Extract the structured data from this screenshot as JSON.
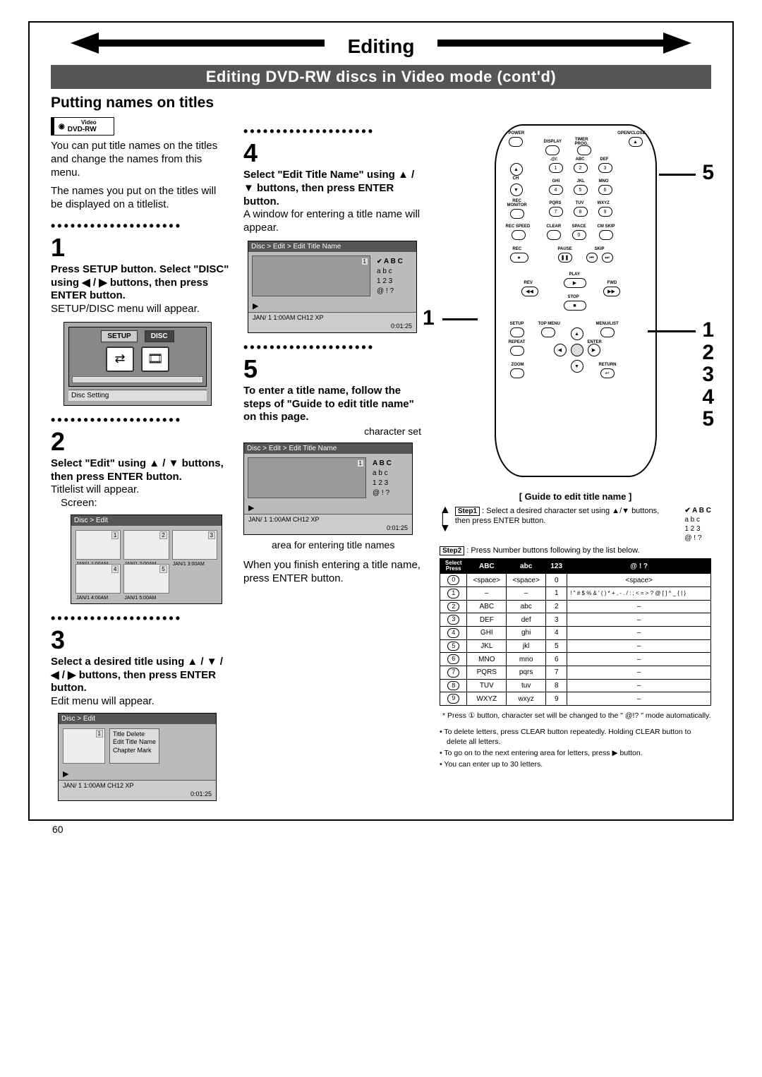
{
  "header": {
    "title": "Editing",
    "subtitle": "Editing DVD-RW discs in Video mode (cont'd)"
  },
  "section_title": "Putting names on titles",
  "badge": {
    "top": "Video",
    "bottom": "DVD-RW"
  },
  "intro": {
    "p1": "You can put title names on the titles and change the names from this menu.",
    "p2": "The names you put on the titles will be displayed on a titlelist."
  },
  "steps": {
    "s1": {
      "num": "1",
      "bold": "Press SETUP button. Select \"DISC\" using ◀ / ▶ buttons, then press ENTER button.",
      "body": "SETUP/DISC menu will appear.",
      "screen": {
        "tab1": "SETUP",
        "tab2": "DISC",
        "footer": "Disc Setting"
      }
    },
    "s2": {
      "num": "2",
      "bold": "Select \"Edit\" using ▲ / ▼ buttons, then press ENTER button.",
      "body": "Titlelist will appear.",
      "screen_label": "Screen:",
      "tl": {
        "header": "Disc > Edit",
        "items": [
          "JAN/1  1:00AM",
          "JAN/1  2:00AM",
          "JAN/1  3:00AM",
          "JAN/1  4:00AM",
          "JAN/1  5:00AM"
        ],
        "nums": [
          "1",
          "2",
          "3",
          "4",
          "5"
        ]
      }
    },
    "s3": {
      "num": "3",
      "bold": "Select a desired title using ▲ / ▼ / ◀ / ▶ buttons, then press ENTER button.",
      "body": "Edit menu will appear.",
      "em": {
        "header": "Disc > Edit",
        "menu": [
          "Title Delete",
          "Edit Title Name",
          "Chapter Mark"
        ],
        "status": "JAN/ 1   1:00AM  CH12     XP",
        "time": "0:01:25",
        "num": "1",
        "play": "▶"
      }
    },
    "s4": {
      "num": "4",
      "bold": "Select \"Edit Title Name\" using ▲ / ▼ buttons, then press ENTER button.",
      "body": "A window for entering a title name will appear.",
      "ent": {
        "header": "Disc > Edit > Edit Title Name",
        "charset": [
          "A B C",
          "a b c",
          "1 2 3",
          "@ ! ?"
        ],
        "status": "JAN/ 1   1:00AM  CH12   XP",
        "time": "0:01:25",
        "num": "1",
        "play": "▶"
      }
    },
    "s5": {
      "num": "5",
      "bold": "To enter a title name, follow the steps of \"Guide to edit title name\" on this page.",
      "cap_charset": "character set",
      "cap_area": "area for entering title names",
      "body2": "When you finish entering a title name, press ENTER button.",
      "ent": {
        "header": "Disc > Edit > Edit Title Name",
        "charset": [
          "A B C",
          "a b c",
          "1 2 3",
          "@ ! ?"
        ],
        "status": "JAN/ 1   1:00AM  CH12   XP",
        "time": "0:01:25",
        "num": "1",
        "play": "▶"
      }
    }
  },
  "remote": {
    "labels": {
      "power": "POWER",
      "openclose": "OPEN/CLOSE",
      "display": "DISPLAY",
      "timerprog": "TIMER\nPROG.",
      "ch": "CH",
      "recmon": "REC\nMONITOR",
      "recspeed": "REC SPEED",
      "clear": "CLEAR",
      "space": "SPACE",
      "cmskip": "CM SKIP",
      "rec": "REC",
      "pause": "PAUSE",
      "skip": "SKIP",
      "play": "PLAY",
      "rev": "REV",
      "fwd": "FWD",
      "stop": "STOP",
      "setup": "SETUP",
      "topmenu": "TOP MENU",
      "menulist": "MENU/LIST",
      "repeat": "REPEAT",
      "enter": "ENTER",
      "zoom": "ZOOM",
      "return": "RETURN",
      "atsign": ".@/:",
      "abc": "ABC",
      "def": "DEF",
      "ghi": "GHI",
      "jkl": "JKL",
      "mno": "MNO",
      "pqrs": "PQRS",
      "tuv": "TUV",
      "wxyz": "WXYZ"
    },
    "numbers": [
      "1",
      "2",
      "3",
      "4",
      "5",
      "6",
      "7",
      "8",
      "9",
      "0"
    ],
    "callout_left": "1",
    "callout_right_top": "5",
    "side_list": "1\n2\n3\n4\n5"
  },
  "guide": {
    "title": "[  Guide to edit title name  ]",
    "step1_label": "Step1",
    "step1_text": ": Select a desired character set using ▲/▼ buttons, then press ENTER button.",
    "step1_charset": [
      "A B C",
      "a b c",
      "1 2 3",
      "@ ! ?"
    ],
    "step2_label": "Step2",
    "step2_text": ": Press Number buttons following by the list below.",
    "table": {
      "headers": [
        "Select\nPress",
        "ABC",
        "abc",
        "123",
        "@ ! ?"
      ],
      "rows": [
        {
          "k": "0",
          "c": [
            "<space>",
            "<space>",
            "0",
            "<space>"
          ]
        },
        {
          "k": "1",
          "c": [
            "–",
            "–",
            "1",
            "! \" # $ % & ' ( ) * + , - . / : ; < = > ? @ [ ] ^ _ { | }"
          ]
        },
        {
          "k": "2",
          "c": [
            "ABC",
            "abc",
            "2",
            "–"
          ]
        },
        {
          "k": "3",
          "c": [
            "DEF",
            "def",
            "3",
            "–"
          ]
        },
        {
          "k": "4",
          "c": [
            "GHI",
            "ghi",
            "4",
            "–"
          ]
        },
        {
          "k": "5",
          "c": [
            "JKL",
            "jkl",
            "5",
            "–"
          ]
        },
        {
          "k": "6",
          "c": [
            "MNO",
            "mno",
            "6",
            "–"
          ]
        },
        {
          "k": "7",
          "c": [
            "PQRS",
            "pqrs",
            "7",
            "–"
          ]
        },
        {
          "k": "8",
          "c": [
            "TUV",
            "tuv",
            "8",
            "–"
          ]
        },
        {
          "k": "9",
          "c": [
            "WXYZ",
            "wxyz",
            "9",
            "–"
          ]
        }
      ]
    },
    "footnote": "* Press ① button, character set will be changed to the \" @!? \" mode automatically.",
    "bullets": [
      "To delete letters, press CLEAR button repeatedly. Holding CLEAR button to delete all letters.",
      "To go on to the next entering area for letters, press ▶ button.",
      "You can enter up to 30 letters."
    ]
  },
  "page_number": "60"
}
